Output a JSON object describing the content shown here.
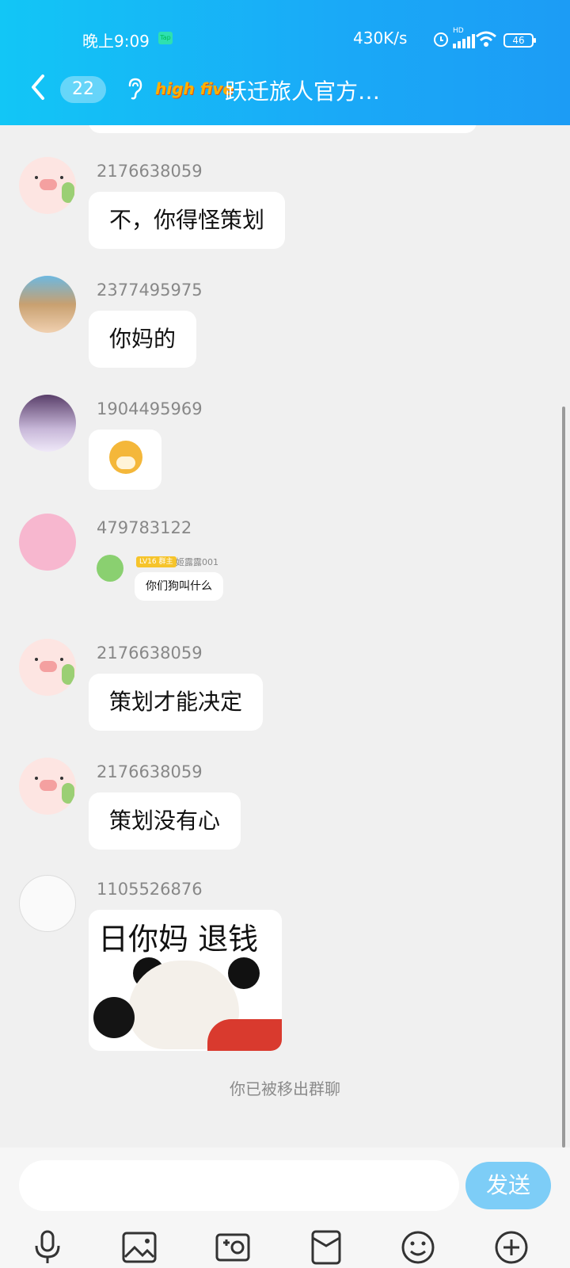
{
  "status_bar": {
    "time": "晚上9:09",
    "app_badge": "Tap",
    "net_speed": "430K/s",
    "signal_label": "HD",
    "battery": "46"
  },
  "header": {
    "back_icon": "chevron-left-icon",
    "unread_count": "22",
    "ear_icon": "ear-icon",
    "logo_text": "high five",
    "title": "跃迁旅人官方…"
  },
  "messages": [
    {
      "uid": "2176638059",
      "text": "不，你得怪策划",
      "avatar": "pig"
    },
    {
      "uid": "2377495975",
      "text": "你妈的",
      "avatar": "cartoon-boy"
    },
    {
      "uid": "1904495969",
      "sticker": "shiba-sticker",
      "avatar": "anime-girl"
    },
    {
      "uid": "479783122",
      "avatar": "pink-character",
      "reply": {
        "level_tag": "LV16 群主",
        "name": "姬露露001",
        "text": "你们狗叫什么"
      }
    },
    {
      "uid": "2176638059",
      "text": "策划才能决定",
      "avatar": "pig"
    },
    {
      "uid": "2176638059",
      "text": "策划没有心",
      "avatar": "pig"
    },
    {
      "uid": "1105526876",
      "avatar": "sketch-character",
      "meme": {
        "caption": "日你妈  退钱"
      }
    }
  ],
  "system_notice": "你已被移出群聊",
  "input": {
    "placeholder": "",
    "send_label": "发送"
  },
  "toolbar": [
    "mic-icon",
    "image-icon",
    "camera-icon",
    "red-packet-icon",
    "emoji-icon",
    "plus-icon"
  ],
  "colors": {
    "header_start": "#12c6f6",
    "header_end": "#1c9cf5",
    "send_button": "#7dcdf7",
    "background": "#f0f0f0"
  }
}
